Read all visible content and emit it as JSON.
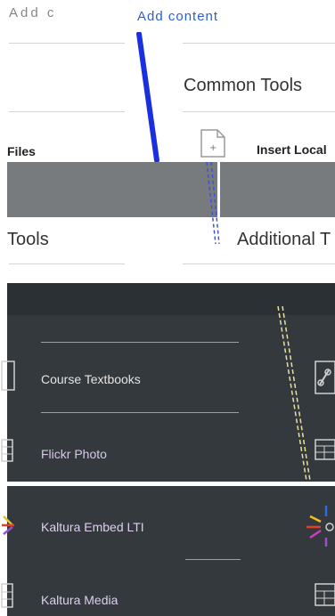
{
  "header": {
    "title_fragment": "Add content",
    "link_text": "Add content"
  },
  "common_tools": {
    "heading": "Common Tools",
    "left_label": "Files",
    "right_label": "Insert Local"
  },
  "additional": {
    "left_heading": "Tools",
    "right_heading": "Additional T"
  },
  "tools": {
    "items": [
      {
        "label": "Course Textbooks"
      },
      {
        "label": "Flickr Photo"
      },
      {
        "label": "Kaltura Embed LTI"
      },
      {
        "label": "Kaltura Media"
      }
    ]
  },
  "colors": {
    "link": "#2a5fd8",
    "band_gray": "#777b7e",
    "panel_dark": "#34393e",
    "accent_blue": "#1a2fe0"
  }
}
